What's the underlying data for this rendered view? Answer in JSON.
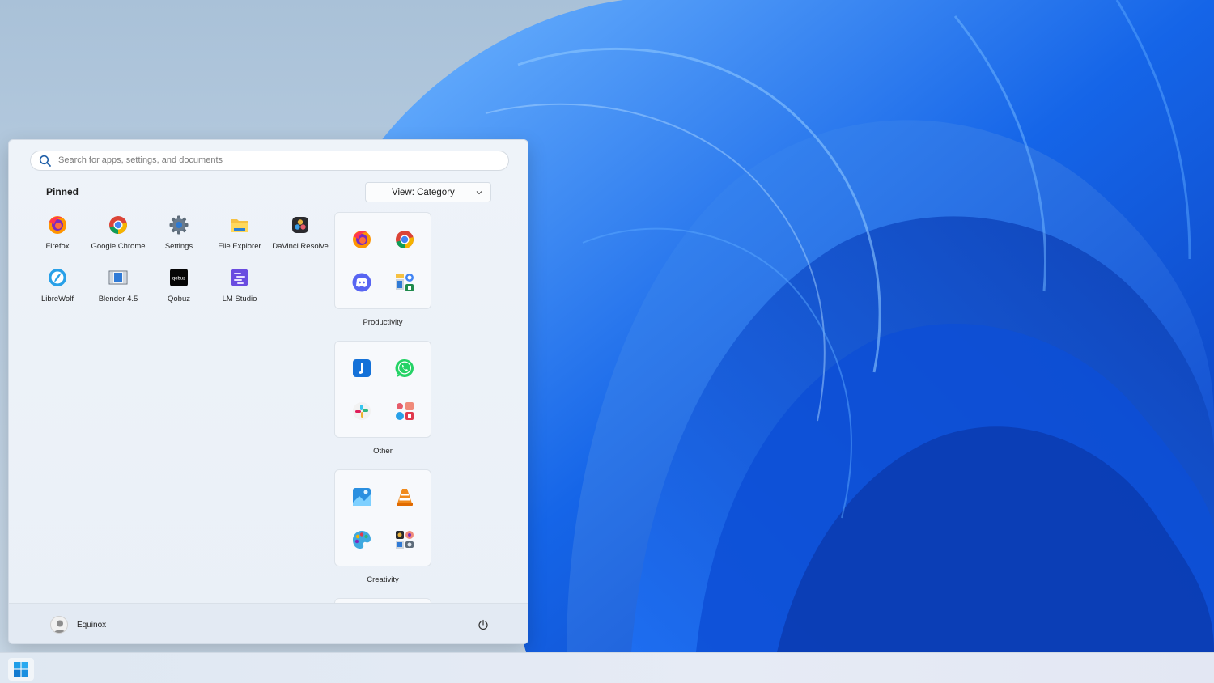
{
  "search": {
    "placeholder": "Search for apps, settings, and documents"
  },
  "pinned": {
    "title": "Pinned",
    "apps": [
      {
        "label": "Firefox",
        "icon": "firefox-icon"
      },
      {
        "label": "Google Chrome",
        "icon": "chrome-icon"
      },
      {
        "label": "Settings",
        "icon": "settings-gear-icon"
      },
      {
        "label": "File Explorer",
        "icon": "folder-icon"
      },
      {
        "label": "DaVinci Resolve",
        "icon": "davinci-resolve-icon"
      },
      {
        "label": "LibreWolf",
        "icon": "librewolf-icon"
      },
      {
        "label": "Blender 4.5",
        "icon": "blender-icon"
      },
      {
        "label": "Qobuz",
        "icon": "qobuz-icon"
      },
      {
        "label": "LM Studio",
        "icon": "lm-studio-icon"
      }
    ]
  },
  "view_button": {
    "label": "View: Category"
  },
  "categories": [
    {
      "label": "Productivity",
      "icons": [
        "firefox-icon",
        "chrome-icon",
        "discord-icon",
        "more-apps-icon"
      ]
    },
    {
      "label": "Other",
      "icons": [
        "joplin-icon",
        "whatsapp-icon",
        "slack-icon",
        "more-apps-icon"
      ]
    },
    {
      "label": "Creativity",
      "icons": [
        "photos-icon",
        "vlc-icon",
        "paint-icon",
        "more-apps-icon"
      ]
    }
  ],
  "footer": {
    "user_name": "Equinox"
  },
  "taskbar": {
    "start_icon": "windows-start-icon"
  },
  "colors": {
    "accent": "#0067c0",
    "wallpaper_blue": "#1a5fe0"
  }
}
